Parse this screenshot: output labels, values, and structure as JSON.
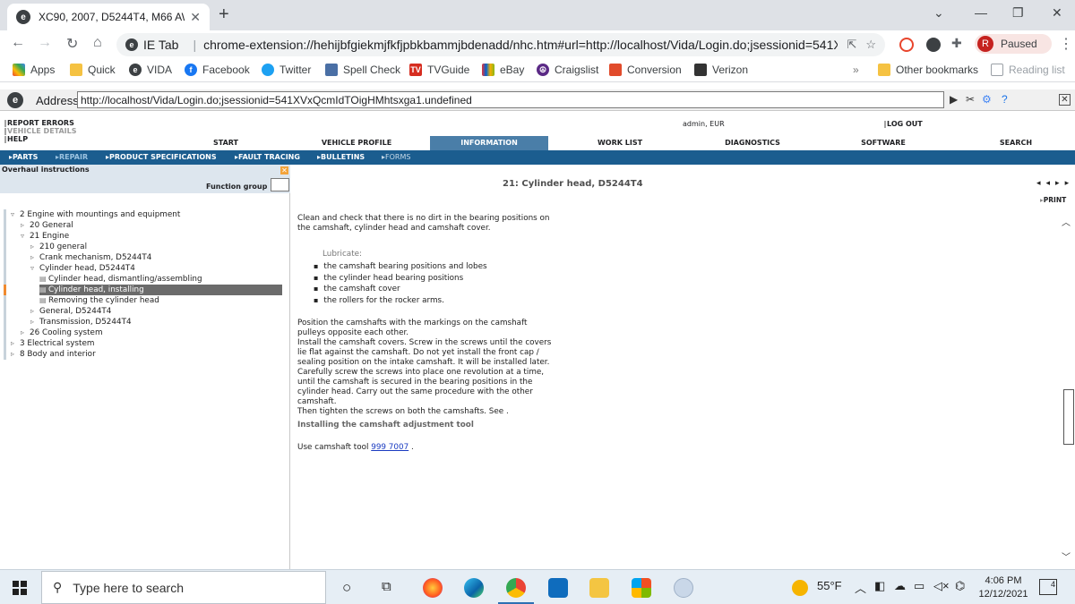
{
  "browser": {
    "tab_title": "XC90, 2007, D5244T4, M66 AWD",
    "tab_favicon": "e",
    "omnibox_prefix": "IE Tab",
    "omnibox_url": "chrome-extension://hehijbfgiekmjfkfjpbkbammjbdenadd/nhc.htm#url=http://localhost/Vida/Login.do;jsessionid=541XVx...",
    "profile_initial": "R",
    "profile_status": "Paused"
  },
  "bookmarks": {
    "items": [
      "Apps",
      "Quick",
      "VIDA",
      "Facebook",
      "Twitter",
      "Spell Check",
      "TVGuide",
      "eBay",
      "Craigslist",
      "Conversion",
      "Verizon"
    ],
    "other": "Other bookmarks",
    "reading_list": "Reading list"
  },
  "ietab": {
    "address_label": "Address:",
    "address_value": "http://localhost/Vida/Login.do;jsessionid=541XVxQcmIdTOigHMhtsxga1.undefined"
  },
  "vida": {
    "links": [
      "REPORT ERRORS",
      "VEHICLE DETAILS",
      "HELP"
    ],
    "user": "admin, EUR",
    "logout": "LOG OUT",
    "topnav": [
      "START",
      "VEHICLE PROFILE",
      "INFORMATION",
      "WORK LIST",
      "DIAGNOSTICS",
      "SOFTWARE",
      "SEARCH"
    ],
    "subnav": [
      "PARTS",
      "REPAIR",
      "PRODUCT SPECIFICATIONS",
      "FAULT TRACING",
      "BULLETINS",
      "FORMS"
    ]
  },
  "leftpane": {
    "title": "Overhaul instructions",
    "function_group_label": "Function group",
    "tree": [
      "2 Engine with mountings and equipment",
      "20 General",
      "21 Engine",
      "210 general",
      "Crank mechanism, D5244T4",
      "Cylinder head, D5244T4",
      "Cylinder head, dismantling/assembling",
      "Cylinder head, installing",
      "Removing the cylinder head",
      "General, D5244T4",
      "Transmission, D5244T4",
      "26 Cooling system",
      "3 Electrical system",
      "8 Body and interior"
    ]
  },
  "content": {
    "heading": "21: Cylinder head, D5244T4",
    "print": "PRINT",
    "p1": "Clean and check that there is no dirt in the bearing positions on the camshaft, cylinder head and camshaft cover.",
    "lubricate": "Lubricate:",
    "bullets": [
      "the camshaft bearing positions and lobes",
      "the cylinder head bearing positions",
      "the camshaft cover",
      "the rollers for the rocker arms."
    ],
    "p2": "Position the camshafts with the markings on the camshaft pulleys opposite each other.",
    "p3": "Install the camshaft covers. Screw in the screws until the covers lie flat against the camshaft. Do not yet install the front cap / sealing position on the intake camshaft. It will be installed later.",
    "p4": "Carefully screw the screws into place one revolution at a time, until the camshaft is secured in the bearing positions in the cylinder head. Carry out the same procedure with the other camshaft.",
    "p5": "Then tighten the screws on both the camshafts. See .",
    "tool_heading": "Installing the camshaft adjustment tool",
    "use_text": "Use camshaft tool",
    "tool_link": "999 7007",
    "use_suffix": "."
  },
  "taskbar": {
    "search_placeholder": "Type here to search",
    "weather": "55°F",
    "time": "4:06 PM",
    "date": "12/12/2021",
    "notifications": "4"
  }
}
